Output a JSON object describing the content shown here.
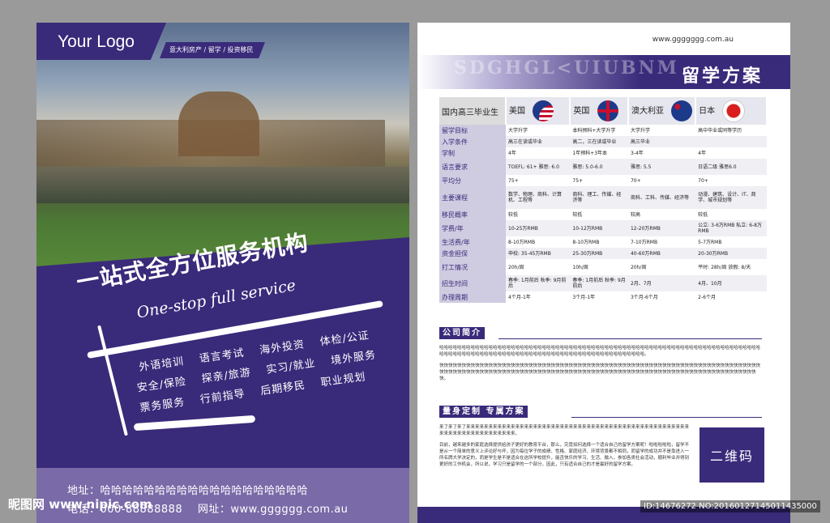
{
  "left": {
    "logo": "Your Logo",
    "tagline": "意大利房产 / 留学 / 投资移民",
    "headline": "一站式全方位服务机构",
    "headline_en": "One-stop full service",
    "services": [
      [
        "外语培训",
        "语言考试",
        "海外投资",
        "体检/公证"
      ],
      [
        "安全/保险",
        "探亲/旅游",
        "实习/就业",
        "境外服务"
      ],
      [
        "票务服务",
        "行前指导",
        "后期移民",
        "职业规划"
      ]
    ],
    "address_label": "地址：",
    "address": "哈哈哈哈哈哈哈哈哈哈哈哈哈哈哈哈哈哈哈",
    "phone_label": "电话：",
    "phone": "000-88888888",
    "web_label": "网址：",
    "web": "www.gggggg.com.au"
  },
  "right": {
    "site": "www.ggggggg.com.au",
    "ghost_text": "SDGHGL<UIUBNM",
    "title": "留学方案",
    "table": {
      "headers": [
        "国内高三毕业生",
        "美国",
        "英国",
        "澳大利亚",
        "日本"
      ],
      "rows": [
        {
          "label": "留学目标",
          "cells": [
            "大学升学",
            "本科预科+大学升学",
            "大学升学",
            "高中毕业或同等学历"
          ]
        },
        {
          "label": "入学条件",
          "cells": [
            "高三在读或毕业",
            "高二，三在读或毕业",
            "高三毕业",
            ""
          ]
        },
        {
          "label": "学制",
          "cells": [
            "4年",
            "1年预科+3年本",
            "3-4年",
            "4年"
          ]
        },
        {
          "label": "语言要求",
          "cells": [
            "TOEFL: 61+ 雅思: 6.0",
            "雅思: 5.0-6.0",
            "雅思: 5.5",
            "日语二级 雅思6.0"
          ]
        },
        {
          "label": "平均分",
          "cells": [
            "75+",
            "75+",
            "70+",
            "70+"
          ]
        },
        {
          "label": "主要课程",
          "cells": [
            "数学、物理、商科、计算机、工程等",
            "商科、理工、传媒、经济等",
            "商科、工科、传媒、经济等",
            "动漫、建筑、设计、IT、商学、城市规划等"
          ]
        },
        {
          "label": "移民概率",
          "cells": [
            "较低",
            "较低",
            "较高",
            "较低"
          ]
        },
        {
          "label": "学费/年",
          "cells": [
            "10-25万RMB",
            "10-12万RMB",
            "12-20万RMB",
            "公立: 3-6万RMB 私立: 6-8万RMB"
          ]
        },
        {
          "label": "生活费/年",
          "cells": [
            "8-10万RMB",
            "8-10万RMB",
            "7-10万RMB",
            "5-7万RMB"
          ]
        },
        {
          "label": "资金担保",
          "cells": [
            "申校: 35-45万RMB",
            "25-30万RMB",
            "40-60万RMB",
            "20-30万RMB"
          ]
        },
        {
          "label": "打工情况",
          "cells": [
            "20h/周",
            "10h/周",
            "20h/周",
            "平时: 28h/周 放假: 8/天"
          ]
        },
        {
          "label": "招生时间",
          "cells": [
            "春季: 1月前后 秋季: 9月前后",
            "春季: 1月前后 秋季: 9月前后",
            "2月、7月",
            "4月、10月"
          ]
        },
        {
          "label": "办理周期",
          "cells": [
            "4个月-1年",
            "3个月-1年",
            "3个月-6个月",
            "2-6个月"
          ]
        }
      ]
    },
    "intro_title": "公司简介",
    "intro_p1": "哈哈哈哈哈哈哈哈哈哈哈哈哈哈哈哈哈哈哈哈哈哈哈哈哈哈哈哈哈哈哈哈哈哈哈哈哈哈哈哈哈哈哈哈哈哈哈哈哈哈哈哈哈哈哈哈哈哈哈哈哈哈哈哈哈哈哈哈哈哈哈哈哈哈哈哈哈哈哈哈哈哈哈哈哈哈哈哈哈哈哈哈哈哈哈哈哈哈哈哈哈哈哈哈哈哈哈哈哈哈哈哈哈哈哈哈哈哈。",
    "intro_p2": "快快快快快快快快快快快快快快快快快快快快快快快快快快快快快快快快快快快快快快快快快快快快快快快快快快快快快快快快快快快快快快快快快快快快快快快快快快快快快快快快快快快快快快快快快快快快快快快快快快快快快快快快快快快快快快快快快快快快快快快快快快快快快快快快快快快快快快快快快快快快快快快快。",
    "custom_title": "量身定制 专属方案",
    "custom_p1": "来了来了来了来来来来来来来来来来来来来来来来来来来来来来来来来来来来来来来来来来来来来来来来来来来来来来来来来来来来来来来来来来来来来来来来来来来。",
    "custom_p2": "目前，越来越多的家庭选择提供给孩子更好的教育平台，那么，究竟如何选择一个适合自己的留学方案呢！啦啦啦啦啦，留学不是从一个简单的意义上评论好与坏，因为每位学子的成绩、性格、家庭经济、环境背景都不相同，而留学的成功并不是靠进入一所名牌大学决定的，而是学生是不是适合在这所学校提升，能否快乐的学习、生活、融入，参加各类社会活动，顺利毕业并得到更好的工作机会，所以说，学习只是留学的一个部分，因此，只有适合自己的才是最好的留学方案。",
    "qr": "二维码"
  },
  "watermark": {
    "left": "昵图网 www.nipic.com",
    "right": "ID:14676272 NO:20160127145011435000"
  },
  "colors": {
    "brand": "#3a2a7a",
    "footer_light": "#7a6aa8"
  }
}
